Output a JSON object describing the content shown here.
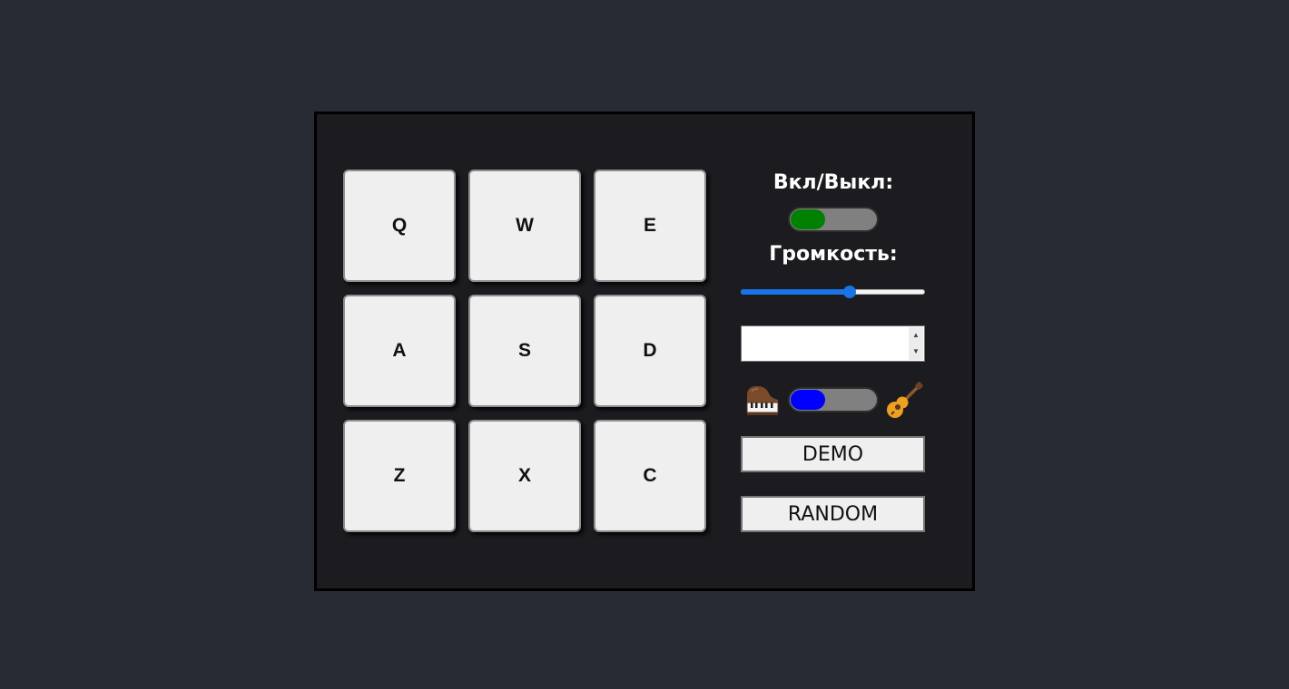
{
  "pads": [
    {
      "key": "Q"
    },
    {
      "key": "W"
    },
    {
      "key": "E"
    },
    {
      "key": "A"
    },
    {
      "key": "S"
    },
    {
      "key": "D"
    },
    {
      "key": "Z"
    },
    {
      "key": "X"
    },
    {
      "key": "C"
    }
  ],
  "controls": {
    "power": {
      "label": "Вкл/Выкл:",
      "on": true,
      "knob_color": "#008000"
    },
    "volume": {
      "label": "Громкость:",
      "value": 0.59
    },
    "display": {
      "value": ""
    },
    "bank": {
      "knob_color": "#0000ff",
      "left_icon": "piano-icon",
      "right_icon": "guitar-icon"
    },
    "demo_label": "DEMO",
    "random_label": "RANDOM"
  },
  "colors": {
    "page_bg": "#282b34",
    "machine_bg": "#1b1b20",
    "pad_bg": "#efefef",
    "accent": "#1a73e8"
  }
}
